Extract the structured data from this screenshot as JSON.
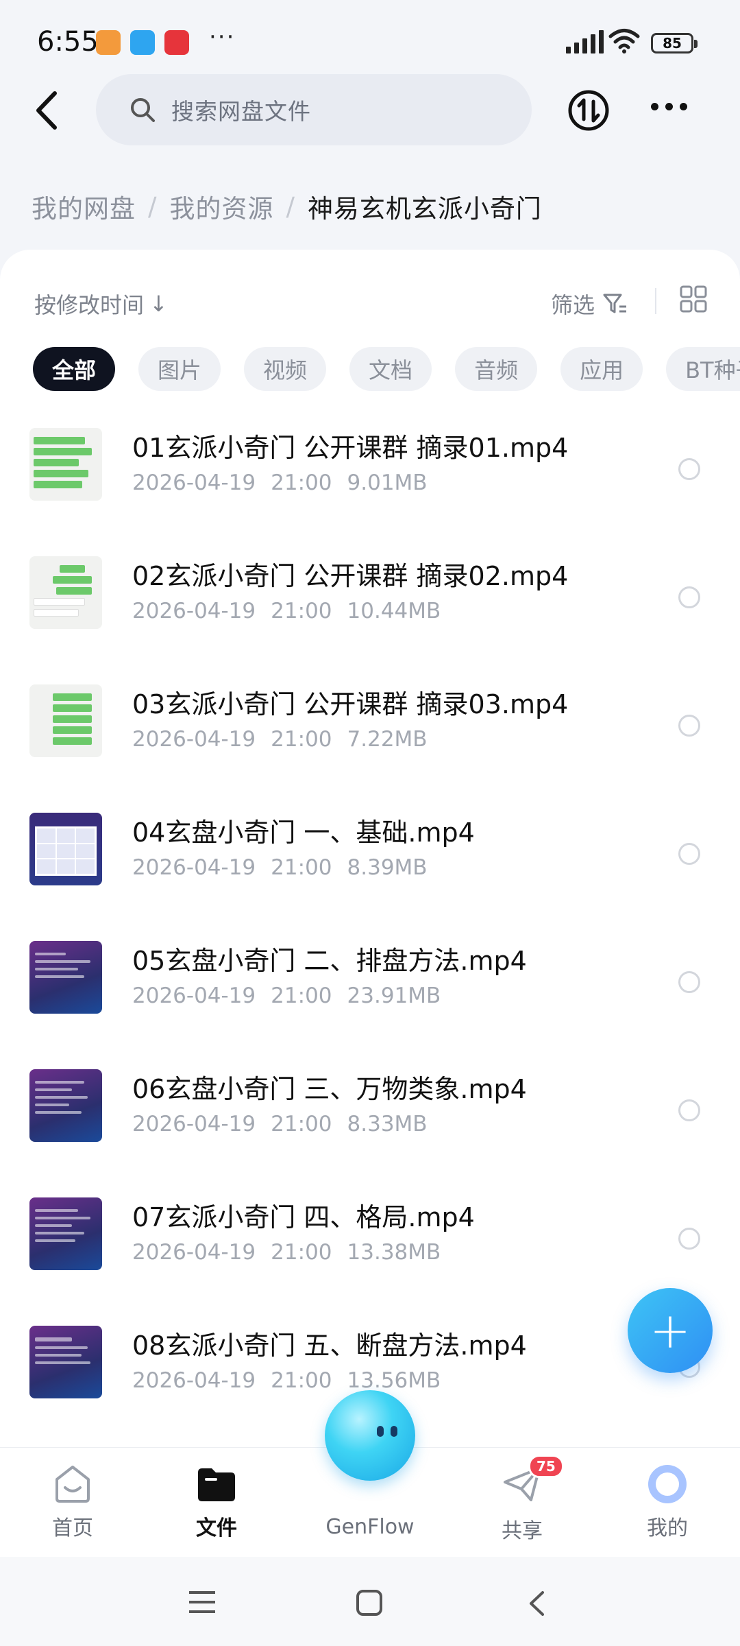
{
  "status_bar": {
    "time": "6:55",
    "battery": "85",
    "app_icons": [
      "app-icon-orange",
      "app-icon-blue",
      "app-icon-red"
    ],
    "more": "···"
  },
  "header": {
    "search_placeholder": "搜索网盘文件",
    "icons": [
      "back-arrow-icon",
      "search-icon",
      "transfer-icon",
      "more-icon"
    ]
  },
  "breadcrumb": {
    "items": [
      "我的网盘",
      "我的资源",
      "神易玄机玄派小奇门"
    ],
    "separator": "/"
  },
  "toolbar": {
    "sort_label": "按修改时间",
    "sort_arrow": "↓",
    "filter_label": "筛选"
  },
  "categories": [
    "全部",
    "图片",
    "视频",
    "文档",
    "音频",
    "应用",
    "BT种子"
  ],
  "active_category": "全部",
  "files": [
    {
      "name": "01玄派小奇门 公开课群 摘录01.mp4",
      "date": "2026-04-19",
      "time": "21:00",
      "size": "9.01MB",
      "thumb": "chat"
    },
    {
      "name": "02玄派小奇门 公开课群 摘录02.mp4",
      "date": "2026-04-19",
      "time": "21:00",
      "size": "10.44MB",
      "thumb": "chat"
    },
    {
      "name": "03玄派小奇门 公开课群 摘录03.mp4",
      "date": "2026-04-19",
      "time": "21:00",
      "size": "7.22MB",
      "thumb": "chat"
    },
    {
      "name": "04玄盘小奇门 一、基础.mp4",
      "date": "2026-04-19",
      "time": "21:00",
      "size": "8.39MB",
      "thumb": "grid"
    },
    {
      "name": "05玄盘小奇门 二、排盘方法.mp4",
      "date": "2026-04-19",
      "time": "21:00",
      "size": "23.91MB",
      "thumb": "dark"
    },
    {
      "name": "06玄盘小奇门 三、万物类象.mp4",
      "date": "2026-04-19",
      "time": "21:00",
      "size": "8.33MB",
      "thumb": "dark"
    },
    {
      "name": "07玄派小奇门 四、格局.mp4",
      "date": "2026-04-19",
      "time": "21:00",
      "size": "13.38MB",
      "thumb": "dark"
    },
    {
      "name": "08玄派小奇门 五、断盘方法.mp4",
      "date": "2026-04-19",
      "time": "21:00",
      "size": "13.56MB",
      "thumb": "dark"
    }
  ],
  "fab_symbol": "+",
  "bottom_nav": {
    "home": "首页",
    "files": "文件",
    "genflow": "GenFlow",
    "share": "共享",
    "share_badge": "75",
    "me": "我的",
    "active": "文件"
  },
  "colors": {
    "accent": "#2f8ff4",
    "chip_active_bg": "#0f1320",
    "badge": "#f04452"
  }
}
